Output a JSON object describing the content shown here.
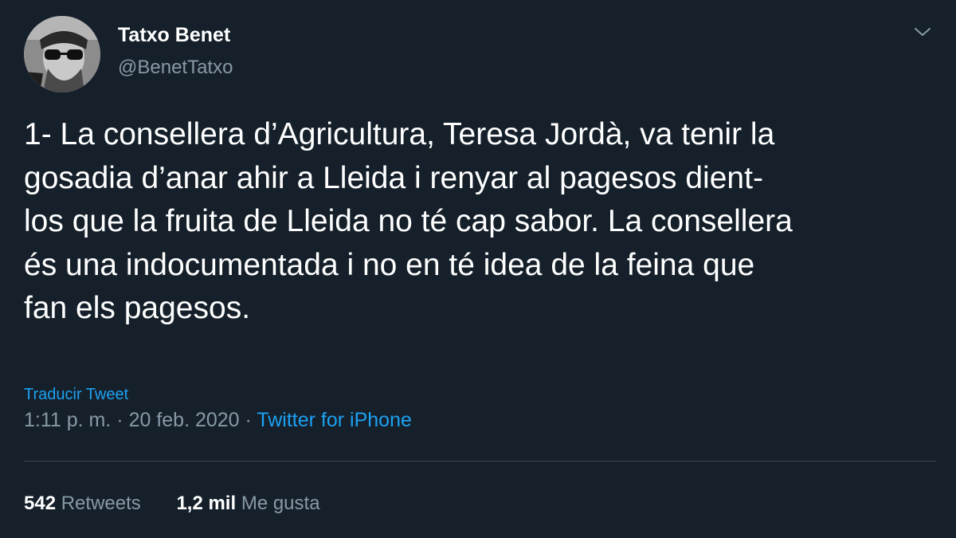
{
  "user": {
    "display_name": "Tatxo Benet",
    "handle": "@BenetTatxo",
    "avatar_icon": "profile-photo"
  },
  "menu": {
    "icon": "chevron-down-icon"
  },
  "tweet": {
    "lines": [
      "1- La consellera d’Agricultura, Teresa Jordà, va tenir la",
      "gosadia d’anar ahir a Lleida i renyar al pagesos dient-",
      "los que la fruita de Lleida no té cap sabor. La consellera",
      "és una indocumentada i no en té idea de la feina que",
      "fan els pagesos."
    ],
    "translate_label": "Traducir Tweet",
    "time": "1:11 p. m.",
    "separator": "·",
    "date": "20 feb. 2020",
    "source": "Twitter for iPhone"
  },
  "stats": {
    "retweets_count": "542",
    "retweets_label": "Retweets",
    "likes_count": "1,2 mil",
    "likes_label": "Me gusta"
  },
  "colors": {
    "background": "#15202b",
    "text": "#ffffff",
    "secondary": "#8899a6",
    "accent": "#1da1f2",
    "divider": "#38444d"
  }
}
